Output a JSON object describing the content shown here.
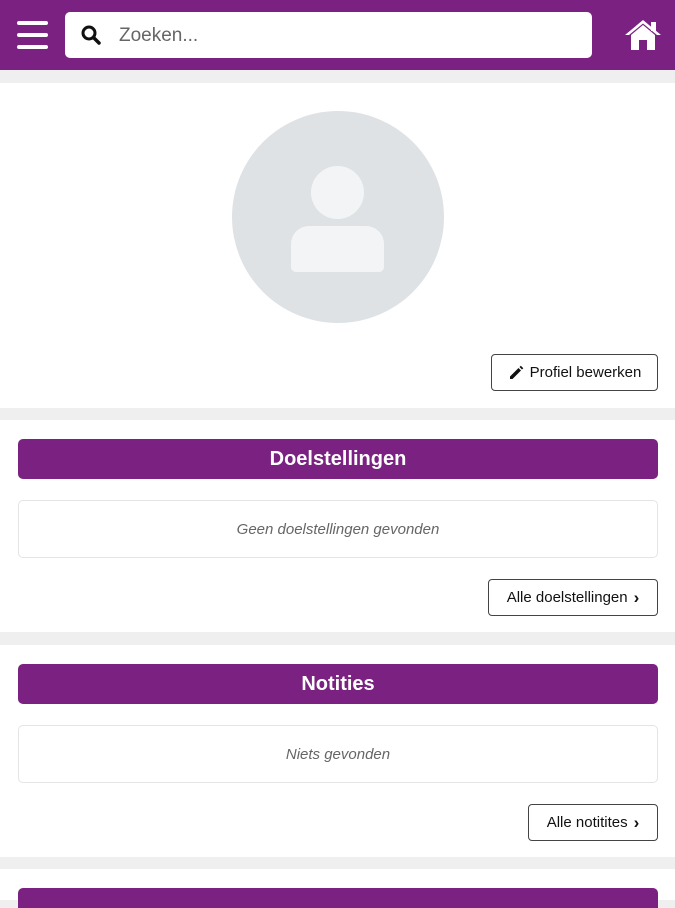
{
  "header": {
    "search_placeholder": "Zoeken...",
    "menu_icon": "hamburger-menu-icon",
    "search_icon": "search-icon",
    "home_icon": "home-icon"
  },
  "profile": {
    "avatar_icon": "user-avatar-placeholder",
    "edit_button_label": "Profiel bewerken"
  },
  "goals": {
    "title": "Doelstellingen",
    "empty_text": "Geen doelstellingen gevonden",
    "all_button_label": "Alle doelstellingen"
  },
  "notes": {
    "title": "Notities",
    "empty_text": "Niets gevonden",
    "all_button_label": "Alle notitites"
  },
  "colors": {
    "brand": "#7a2182",
    "background": "#efefef",
    "avatar": "#dfe2e5"
  }
}
